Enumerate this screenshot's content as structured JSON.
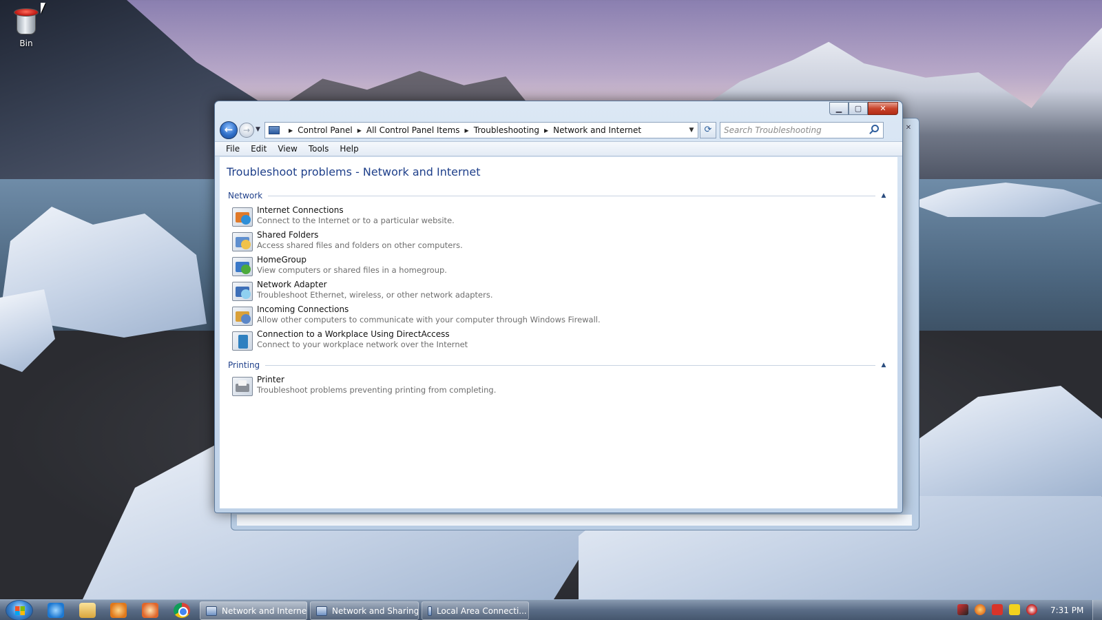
{
  "desktop": {
    "icons": [
      {
        "label": "Bin",
        "icon": "recycle-bin-icon"
      }
    ]
  },
  "window": {
    "address": {
      "crumbs": [
        "Control Panel",
        "All Control Panel Items",
        "Troubleshooting",
        "Network and Internet"
      ]
    },
    "search": {
      "placeholder": "Search Troubleshooting"
    },
    "menu": [
      "File",
      "Edit",
      "View",
      "Tools",
      "Help"
    ],
    "title": "Troubleshoot problems - Network and Internet",
    "groups": [
      {
        "name": "Network",
        "items": [
          {
            "title": "Internet Connections",
            "desc": "Connect to the Internet or to a particular website.",
            "icon": "internet-connections-icon"
          },
          {
            "title": "Shared Folders",
            "desc": "Access shared files and folders on other computers.",
            "icon": "shared-folders-icon"
          },
          {
            "title": "HomeGroup",
            "desc": "View computers or shared files in a homegroup.",
            "icon": "homegroup-icon"
          },
          {
            "title": "Network Adapter",
            "desc": "Troubleshoot Ethernet, wireless, or other network adapters.",
            "icon": "network-adapter-icon"
          },
          {
            "title": "Incoming Connections",
            "desc": "Allow other computers to communicate with your computer through Windows Firewall.",
            "icon": "incoming-connections-icon"
          },
          {
            "title": "Connection to a Workplace Using DirectAccess",
            "desc": "Connect to your workplace network over the Internet",
            "icon": "directaccess-icon"
          }
        ]
      },
      {
        "name": "Printing",
        "items": [
          {
            "title": "Printer",
            "desc": "Troubleshoot problems preventing printing from completing.",
            "icon": "printer-icon"
          }
        ]
      }
    ]
  },
  "taskbar": {
    "pinned": [
      "internet-explorer-icon",
      "windows-explorer-icon",
      "media-player-icon",
      "paint-icon",
      "chrome-icon"
    ],
    "buttons": [
      {
        "label": "Network and Internet",
        "active": true
      },
      {
        "label": "Network and Sharing...",
        "active": false
      },
      {
        "label": "Local Area Connecti...",
        "active": false
      }
    ],
    "tray_icons": [
      "action-center-icon",
      "search-tray-icon",
      "flag-icon",
      "battery-icon",
      "power-icon"
    ],
    "clock": "7:31 PM"
  },
  "colors": {
    "title_blue": "#1e3f8a",
    "desc_gray": "#6d6d6d",
    "close_red": "#c8442b"
  }
}
